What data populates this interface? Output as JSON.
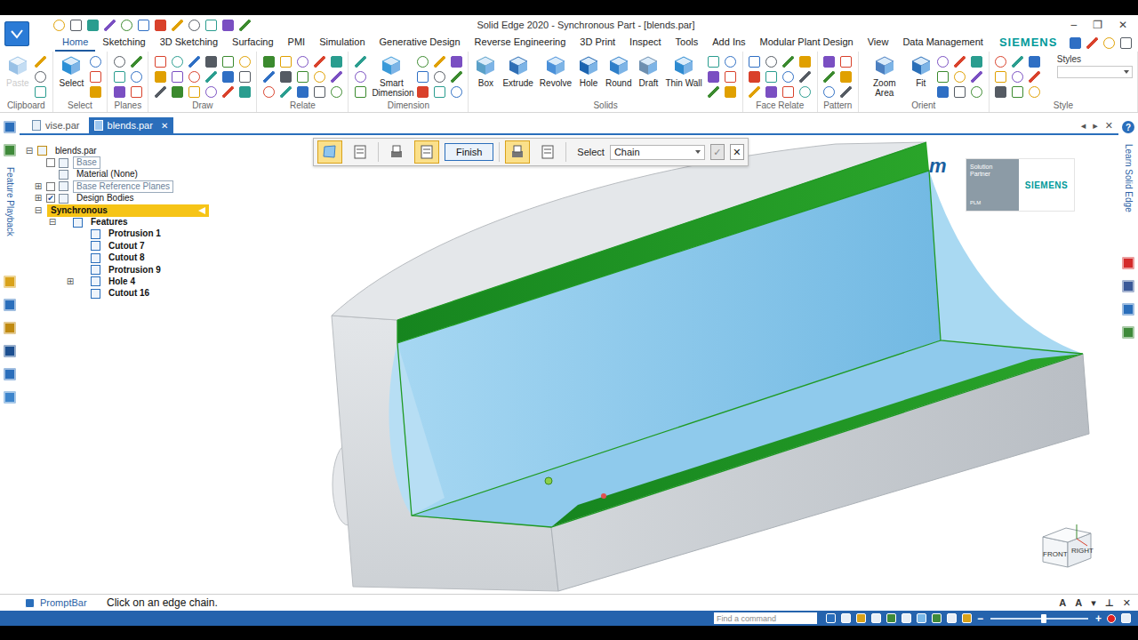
{
  "window": {
    "title": "Solid Edge 2020 - Synchronous Part - [blends.par]",
    "controls": [
      "–",
      "❐",
      "✕"
    ]
  },
  "ribbon": {
    "tabs": [
      {
        "label": "Home",
        "selected": true
      },
      {
        "label": "Sketching",
        "selected": false
      },
      {
        "label": "3D Sketching",
        "selected": false
      },
      {
        "label": "Surfacing",
        "selected": false
      },
      {
        "label": "PMI",
        "selected": false
      },
      {
        "label": "Simulation",
        "selected": false
      },
      {
        "label": "Generative Design",
        "selected": false
      },
      {
        "label": "Reverse Engineering",
        "selected": false
      },
      {
        "label": "3D Print",
        "selected": false
      },
      {
        "label": "Inspect",
        "selected": false
      },
      {
        "label": "Tools",
        "selected": false
      },
      {
        "label": "Add Ins",
        "selected": false
      },
      {
        "label": "Modular Plant Design",
        "selected": false
      },
      {
        "label": "View",
        "selected": false
      },
      {
        "label": "Data Management",
        "selected": false
      }
    ],
    "brand": "SIEMENS",
    "groups": [
      {
        "label": "Clipboard",
        "buttons": [
          {
            "label": "Paste",
            "disabled": true
          }
        ]
      },
      {
        "label": "Select",
        "buttons": [
          {
            "label": "Select",
            "disabled": false
          }
        ]
      },
      {
        "label": "Planes",
        "buttons": []
      },
      {
        "label": "Draw",
        "buttons": []
      },
      {
        "label": "Relate",
        "buttons": []
      },
      {
        "label": "Dimension",
        "buttons": [
          {
            "label": "Smart Dimension",
            "disabled": false
          }
        ]
      },
      {
        "label": "Solids",
        "buttons": [
          {
            "label": "Box",
            "disabled": false
          },
          {
            "label": "Extrude",
            "disabled": false
          },
          {
            "label": "Revolve",
            "disabled": false
          },
          {
            "label": "Hole",
            "disabled": false
          },
          {
            "label": "Round",
            "disabled": false
          },
          {
            "label": "Draft",
            "disabled": false
          },
          {
            "label": "Thin Wall",
            "disabled": false
          }
        ]
      },
      {
        "label": "Face Relate",
        "buttons": []
      },
      {
        "label": "Pattern",
        "buttons": []
      },
      {
        "label": "Orient",
        "buttons": [
          {
            "label": "Zoom Area",
            "disabled": false
          },
          {
            "label": "Fit",
            "disabled": false
          }
        ]
      },
      {
        "label": "Style",
        "buttons": []
      }
    ],
    "styles_label": "Styles"
  },
  "doc_tabs": [
    {
      "label": "vise.par",
      "selected": false
    },
    {
      "label": "blends.par",
      "selected": true
    }
  ],
  "doc_tab_close": "✕",
  "doc_tab_nav": [
    "◂",
    "▸",
    "✕"
  ],
  "left_strip": {
    "label": "Feature Playback"
  },
  "right_strip": {
    "label": "Learn Solid Edge",
    "help": "?"
  },
  "tree": [
    {
      "label": "blends.par",
      "level": 0,
      "expander": "⊟",
      "checkbox": false,
      "checked": false,
      "selected": false,
      "dimmed": false,
      "bold": false
    },
    {
      "label": "Base",
      "level": 1,
      "expander": "",
      "checkbox": true,
      "checked": false,
      "selected": false,
      "dimmed": true,
      "bold": false
    },
    {
      "label": "Material (None)",
      "level": 1,
      "expander": "",
      "checkbox": false,
      "checked": false,
      "selected": false,
      "dimmed": false,
      "bold": false
    },
    {
      "label": "Base Reference Planes",
      "level": 1,
      "expander": "⊞",
      "checkbox": true,
      "checked": false,
      "selected": false,
      "dimmed": true,
      "bold": false
    },
    {
      "label": "Design Bodies",
      "level": 1,
      "expander": "⊞",
      "checkbox": true,
      "checked": true,
      "selected": false,
      "dimmed": false,
      "bold": false
    },
    {
      "label": "Synchronous",
      "level": 1,
      "expander": "⊟",
      "checkbox": false,
      "checked": false,
      "selected": true,
      "dimmed": false,
      "bold": true
    },
    {
      "label": "Features",
      "level": 2,
      "expander": "⊟",
      "checkbox": false,
      "checked": false,
      "selected": false,
      "dimmed": false,
      "bold": true
    },
    {
      "label": "Protrusion 1",
      "level": 3,
      "expander": "",
      "checkbox": false,
      "checked": false,
      "selected": false,
      "dimmed": false,
      "bold": true
    },
    {
      "label": "Cutout 7",
      "level": 3,
      "expander": "",
      "checkbox": false,
      "checked": false,
      "selected": false,
      "dimmed": false,
      "bold": true
    },
    {
      "label": "Cutout 8",
      "level": 3,
      "expander": "",
      "checkbox": false,
      "checked": false,
      "selected": false,
      "dimmed": false,
      "bold": true
    },
    {
      "label": "Protrusion 9",
      "level": 3,
      "expander": "",
      "checkbox": false,
      "checked": false,
      "selected": false,
      "dimmed": false,
      "bold": true
    },
    {
      "label": "Hole 4",
      "level": 3,
      "expander": "⊞",
      "checkbox": false,
      "checked": false,
      "selected": false,
      "dimmed": false,
      "bold": true
    },
    {
      "label": "Cutout 16",
      "level": 3,
      "expander": "",
      "checkbox": false,
      "checked": false,
      "selected": false,
      "dimmed": false,
      "bold": true
    }
  ],
  "command_bar": {
    "tools_before": [
      {
        "selected": true
      },
      {
        "selected": false
      },
      {
        "selected": false
      },
      {
        "selected": true
      }
    ],
    "finish": "Finish",
    "tools_after": [
      {
        "selected": true
      },
      {
        "selected": false
      }
    ],
    "select_label": "Select",
    "select_value": "Chain",
    "ok": "✓",
    "cancel": "✕"
  },
  "watermark": "m",
  "partner": {
    "line1": "Solution",
    "line2": "Partner",
    "line3": "PLM",
    "brand": "SIEMENS"
  },
  "view_cube": {
    "front": "FRONT",
    "right": "RIGHT"
  },
  "prompt": {
    "label": "PromptBar",
    "text": "Click on an edge chain.",
    "controls": [
      "A",
      "A",
      "▾",
      "⊥",
      "✕"
    ]
  },
  "status": {
    "search_placeholder": "Find a command",
    "zoom_level": 0.55,
    "zoom_minus": "−",
    "zoom_plus": "+"
  }
}
